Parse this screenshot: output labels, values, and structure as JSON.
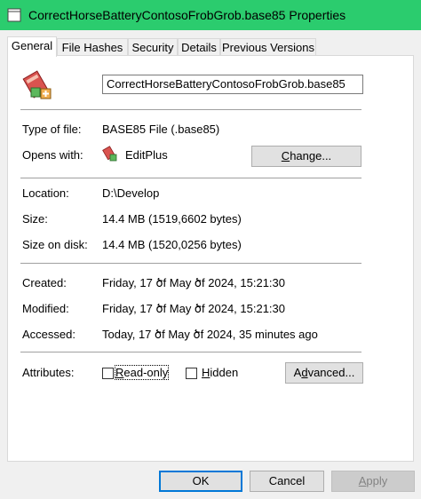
{
  "window": {
    "title": "CorrectHorseBatteryContosoFrobGrob.base85 Properties"
  },
  "tabs": [
    {
      "label": "General",
      "active": true
    },
    {
      "label": "File Hashes",
      "active": false
    },
    {
      "label": "Security",
      "active": false
    },
    {
      "label": "Details",
      "active": false
    },
    {
      "label": "Previous Versions",
      "active": false
    }
  ],
  "general": {
    "file_name": "CorrectHorseBatteryContosoFrobGrob.base85",
    "type_label": "Type of file:",
    "type_value": "BASE85 File (.base85)",
    "opens_label": "Opens with:",
    "opens_value": "EditPlus",
    "change_button": "Change...",
    "location_label": "Location:",
    "location_value": "D:\\Develop",
    "size_label": "Size:",
    "size_value": "14.4 MB (1519,6602 bytes)",
    "size_disk_label": "Size on disk:",
    "size_disk_value": "14.4 MB (1520,0256 bytes)",
    "created_label": "Created:",
    "created_value": "Friday, 17 ծf May ծf 2024, 15:21:30",
    "modified_label": "Modified:",
    "modified_value": "Friday, 17 ծf May ծf 2024, 15:21:30",
    "accessed_label": "Accessed:",
    "accessed_value": "Today, 17 ծf May ծf 2024, 35 minutes ago",
    "attributes_label": "Attributes:",
    "readonly_label": "Read-only",
    "readonly_checked": false,
    "hidden_label": "Hidden",
    "hidden_checked": false,
    "advanced_button": "Advanced..."
  },
  "footer": {
    "ok": "OK",
    "cancel": "Cancel",
    "apply": "Apply"
  },
  "colors": {
    "titlebar": "#2bcc6e",
    "accent": "#0078d7"
  },
  "icons": {
    "file": "editplus-file-icon",
    "app": "editplus-app-icon"
  }
}
